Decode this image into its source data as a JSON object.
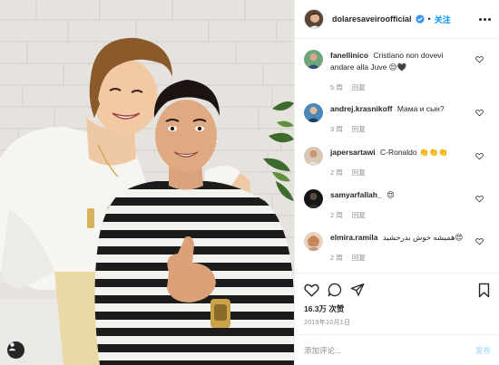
{
  "post": {
    "username": "dolaresaveiroofficial",
    "separator": "•",
    "follow_label": "关注",
    "likes": "16.3万 次赞",
    "date": "2019年10月1日",
    "add_comment_placeholder": "添加评论...",
    "post_label": "发布",
    "icons": {
      "verified": "verified-badge-icon",
      "more": "more-options-icon",
      "like": "heart-icon",
      "comment": "comment-icon",
      "share": "share-icon",
      "save": "bookmark-icon",
      "user_tag": "user-tag-icon"
    },
    "colors": {
      "accent": "#0095f6",
      "verified": "#3897f0",
      "muted": "#8e8e8e"
    }
  },
  "comments": [
    {
      "user": "fanellinico",
      "text": "Cristiano non dovevi andare alla Juve 😌🖤",
      "time": "5 周",
      "reply": "回复"
    },
    {
      "user": "andrej.krasnikoff",
      "text": "Мама и сын?",
      "time": "3 周",
      "reply": "回复"
    },
    {
      "user": "japersartawi",
      "text": "C-Ronaldo 👏👏👏",
      "time": "2 周",
      "reply": "回复"
    },
    {
      "user": "samyarfallah_",
      "text": "😍",
      "time": "2 周",
      "reply": "回复"
    },
    {
      "user": "elmira.ramila",
      "text": "هميشه خوش بدرخشيد😍",
      "time": "2 周",
      "reply": "回复"
    }
  ]
}
